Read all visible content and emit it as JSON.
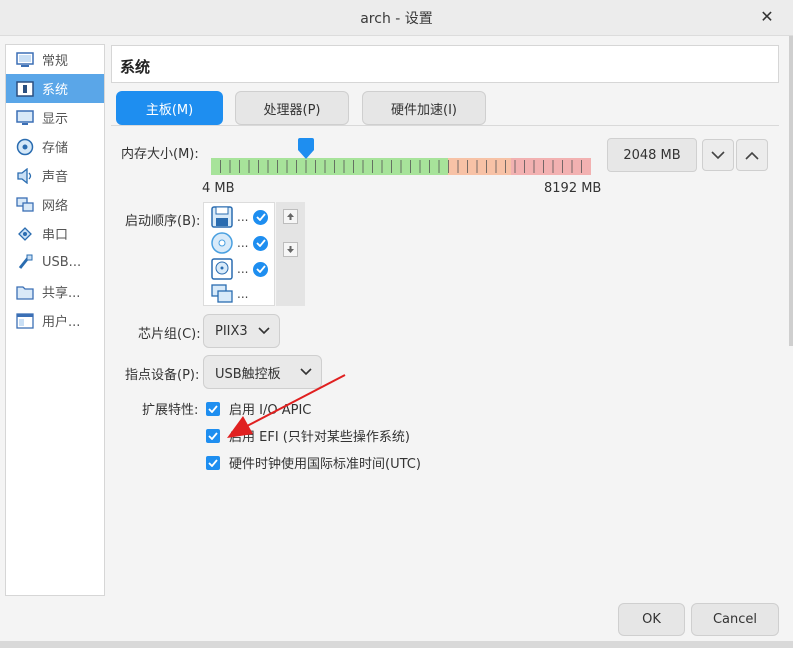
{
  "window": {
    "title": "arch - 设置"
  },
  "sidebar": {
    "items": [
      {
        "label": "常规",
        "icon": "general-icon"
      },
      {
        "label": "系统",
        "icon": "system-icon",
        "active": true
      },
      {
        "label": "显示",
        "icon": "display-icon"
      },
      {
        "label": "存储",
        "icon": "storage-icon"
      },
      {
        "label": "声音",
        "icon": "audio-icon"
      },
      {
        "label": "网络",
        "icon": "network-icon"
      },
      {
        "label": "串口",
        "icon": "serial-port-icon"
      },
      {
        "label": "USB...",
        "icon": "usb-icon"
      },
      {
        "label": "共享...",
        "icon": "shared-folder-icon"
      },
      {
        "label": "用户...",
        "icon": "user-interface-icon"
      }
    ]
  },
  "section": {
    "title": "系统"
  },
  "tabs": [
    {
      "label": "主板(M)",
      "active": true
    },
    {
      "label": "处理器(P)"
    },
    {
      "label": "硬件加速(I)"
    }
  ],
  "memory": {
    "label": "内存大小(M):",
    "min_label": "4 MB",
    "max_label": "8192 MB",
    "value_text": "2048 MB",
    "value_mb": 2048,
    "min_mb": 4,
    "max_mb": 8192
  },
  "boot_order": {
    "label": "启动顺序(B):",
    "items": [
      {
        "icon": "floppy-icon",
        "text": "...",
        "checked": true
      },
      {
        "icon": "optical-disc-icon",
        "text": "...",
        "checked": true
      },
      {
        "icon": "hard-disk-icon",
        "text": "...",
        "checked": true
      },
      {
        "icon": "network-boot-icon",
        "text": "...",
        "checked": false
      }
    ]
  },
  "chipset": {
    "label": "芯片组(C):",
    "value": "PIIX3"
  },
  "pointing": {
    "label": "指点设备(P):",
    "value": "USB触控板"
  },
  "extended": {
    "label": "扩展特性:",
    "options": [
      {
        "label": "启用 I/O APIC",
        "checked": true
      },
      {
        "label": "启用 EFI (只针对某些操作系统)",
        "checked": true
      },
      {
        "label": "硬件时钟使用国际标准时间(UTC)",
        "checked": true
      }
    ]
  },
  "buttons": {
    "ok": "OK",
    "cancel": "Cancel"
  },
  "colors": {
    "accent": "#1e8ef0",
    "sidebar_active": "#5aa6e8",
    "arrow": "#e02020"
  }
}
